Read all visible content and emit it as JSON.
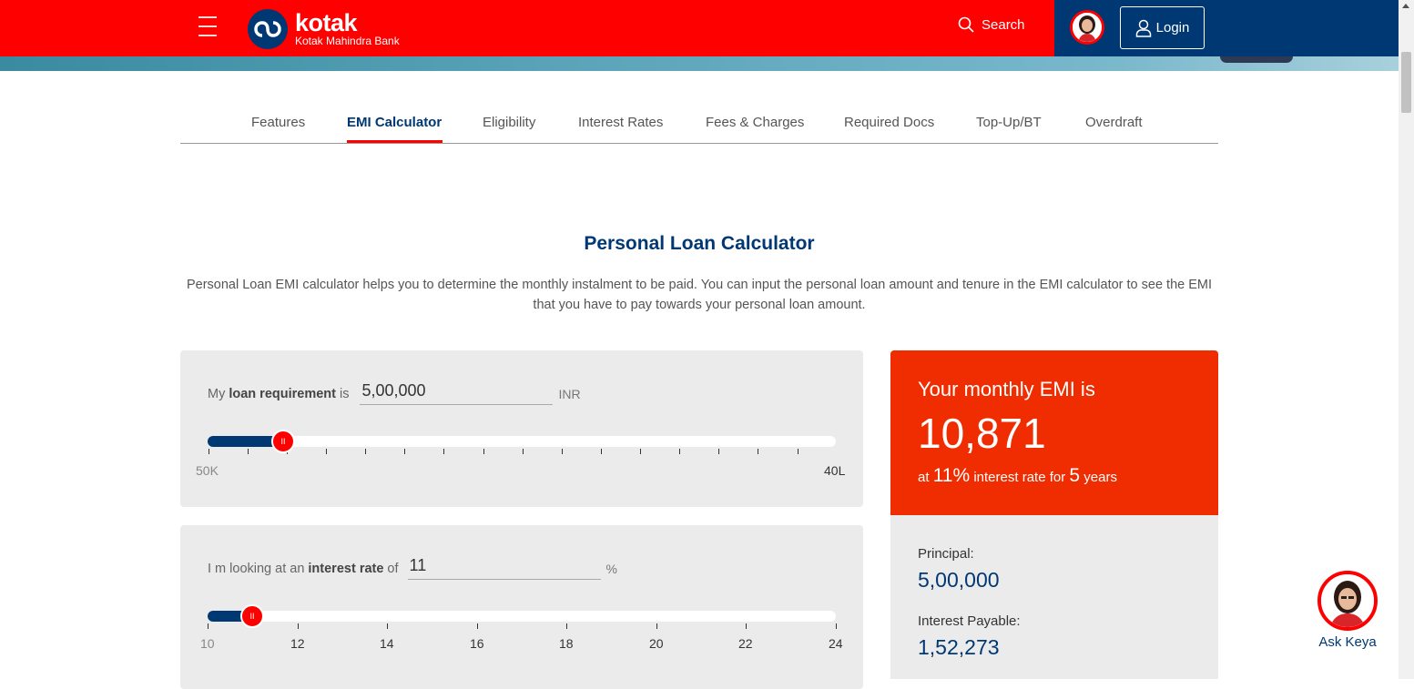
{
  "header": {
    "brand": "kotak",
    "brand_sub": "Kotak Mahindra Bank",
    "search_label": "Search",
    "login_label": "Login"
  },
  "tabs": [
    {
      "label": "Features"
    },
    {
      "label": "EMI Calculator"
    },
    {
      "label": "Eligibility"
    },
    {
      "label": "Interest Rates"
    },
    {
      "label": "Fees & Charges"
    },
    {
      "label": "Required Docs"
    },
    {
      "label": "Top-Up/BT"
    },
    {
      "label": "Overdraft"
    }
  ],
  "calculator": {
    "title": "Personal Loan Calculator",
    "description": "Personal Loan EMI calculator helps you to determine the monthly instalment to be paid. You can input the personal loan amount and tenure in the EMI calculator to see the EMI that you have to pay towards your personal loan amount.",
    "loan": {
      "prefix": "My",
      "bold": "loan requirement",
      "suffix": "is",
      "value": "5,00,000",
      "unit": "INR",
      "min_label": "50K",
      "max_label": "40L",
      "slider_fraction": 0.12
    },
    "interest": {
      "prefix": "I m looking at an",
      "bold": "interest rate",
      "suffix": "of",
      "value": "11",
      "unit": "%",
      "tick_labels": [
        "10",
        "12",
        "14",
        "16",
        "18",
        "20",
        "22",
        "24"
      ],
      "slider_fraction": 0.0714
    }
  },
  "result": {
    "label": "Your monthly EMI is",
    "emi": "10,871",
    "sub_at": "at",
    "rate": "11%",
    "sub_rate_text": "interest rate for",
    "years": "5",
    "sub_years_text": "years",
    "principal_label": "Principal:",
    "principal_value": "5,00,000",
    "interest_label": "Interest Payable:",
    "interest_value": "1,52,273"
  },
  "assistant": {
    "label": "Ask Keya"
  },
  "colors": {
    "brand_red": "#ff0000",
    "brand_navy": "#003874",
    "result_red": "#f02d00"
  }
}
